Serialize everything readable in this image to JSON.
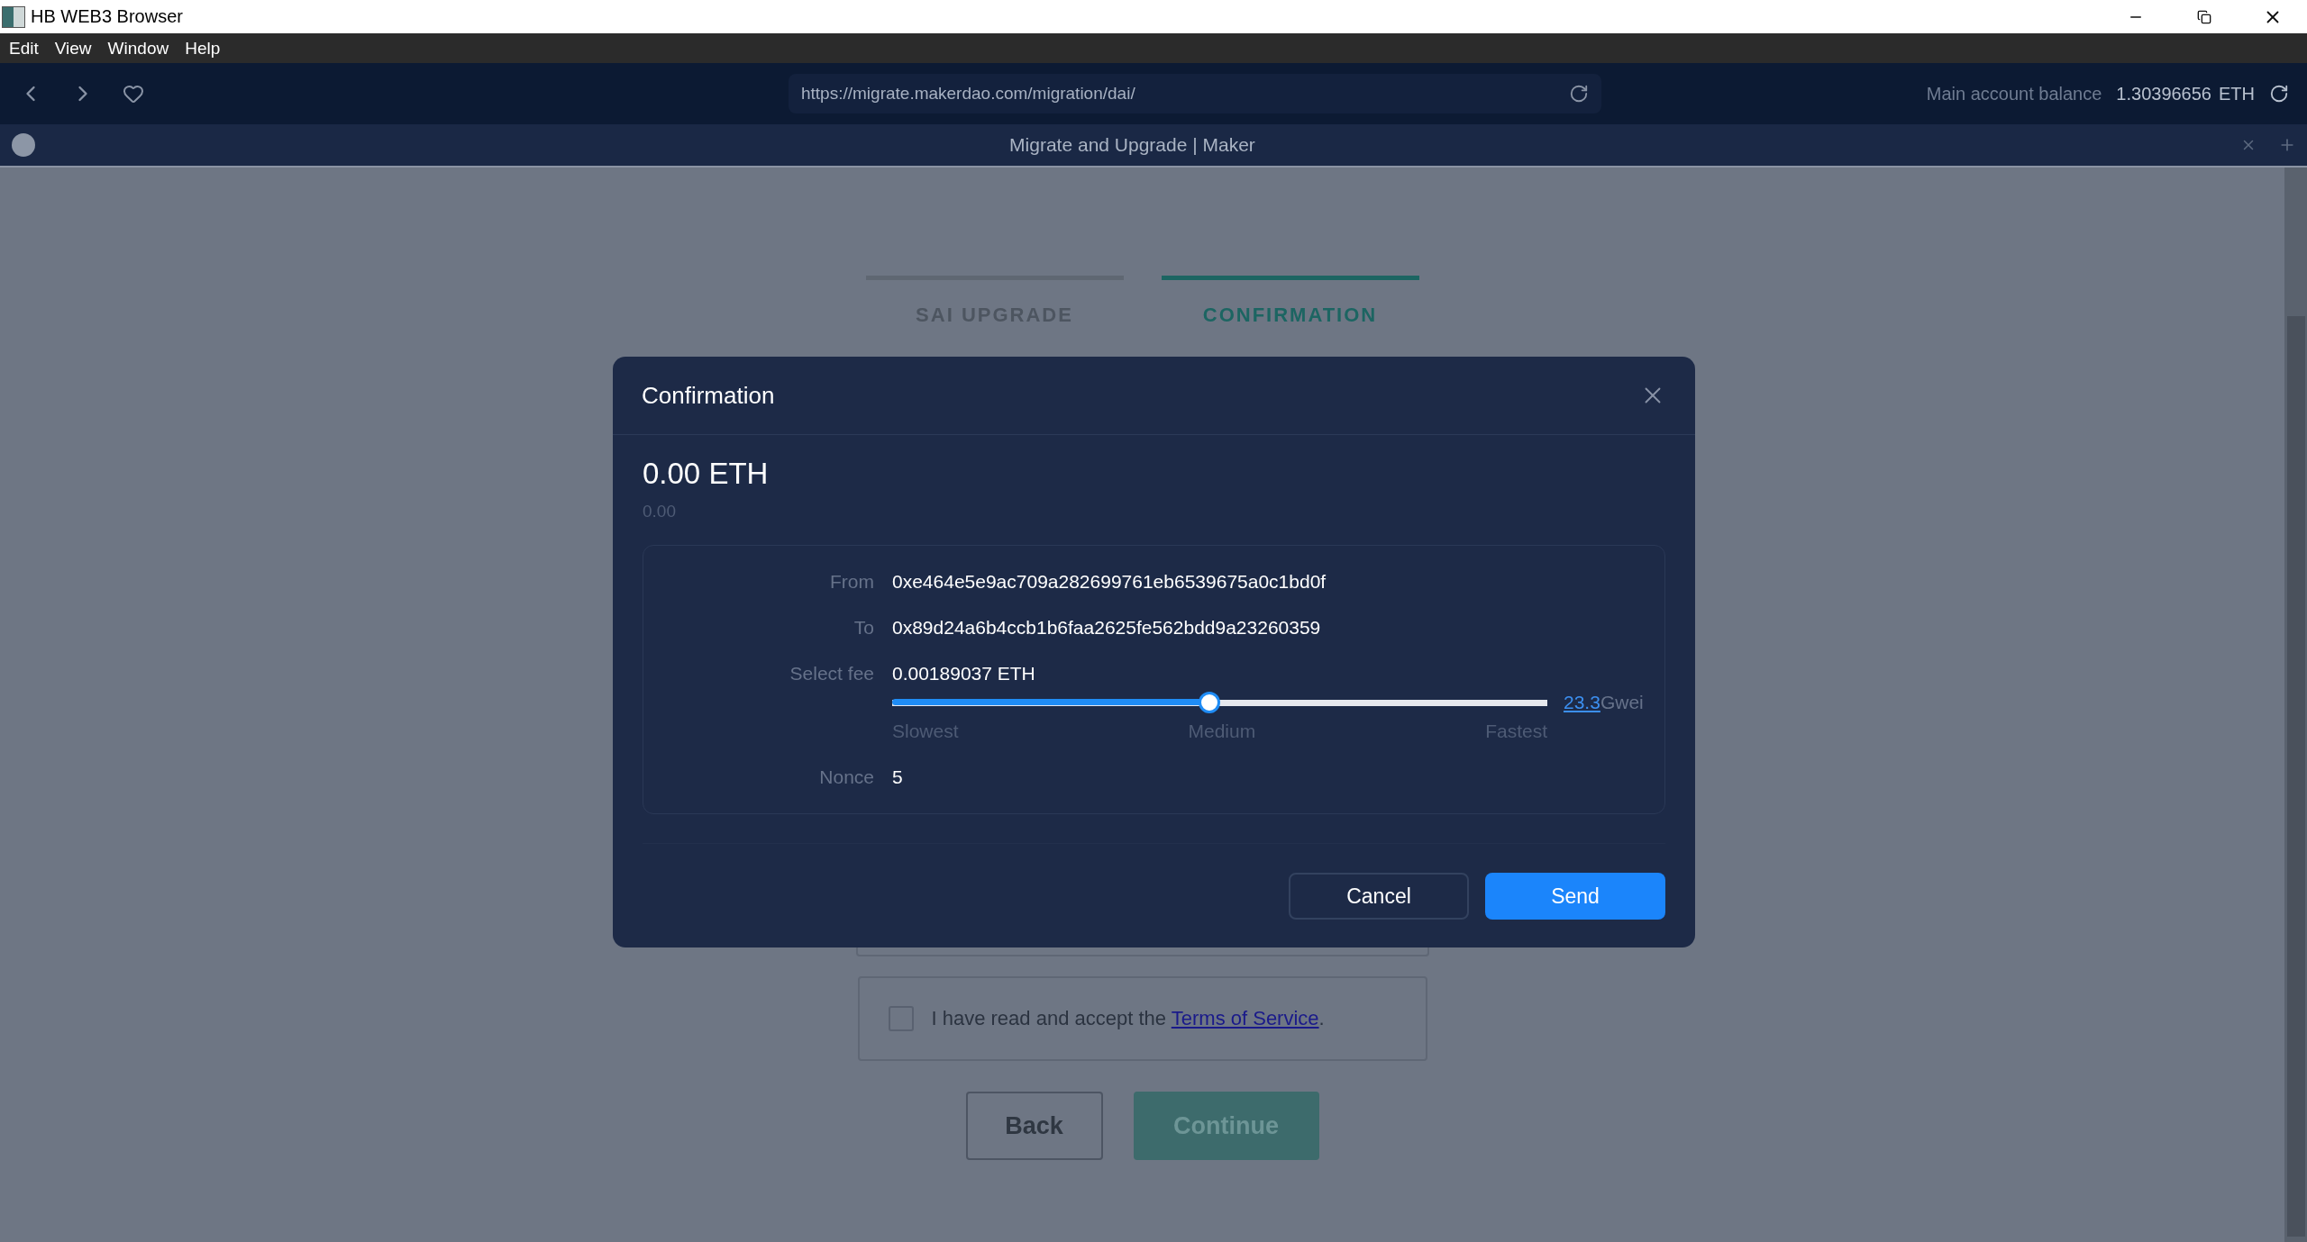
{
  "window": {
    "title": "HB WEB3 Browser"
  },
  "menu": [
    "Edit",
    "View",
    "Window",
    "Help"
  ],
  "nav": {
    "url": "https://migrate.makerdao.com/migration/dai/",
    "balance_label": "Main account balance",
    "balance_value": "1.30396656",
    "balance_unit": "ETH"
  },
  "tab": {
    "title": "Migrate and Upgrade | Maker"
  },
  "steps": [
    {
      "label": "SAI UPGRADE",
      "selected": false
    },
    {
      "label": "CONFIRMATION",
      "selected": true
    }
  ],
  "terms": {
    "checked": false,
    "text": "I have read and accept the",
    "link": "Terms of Service",
    "after": "."
  },
  "buttons": [
    {
      "label": "Back",
      "kind": "secondary"
    },
    {
      "label": "Continue",
      "kind": "primary"
    }
  ],
  "dialog": {
    "title": "Confirmation",
    "amount": "0.00 ETH",
    "amount_sub": "0.00",
    "rows": [
      {
        "label": "From",
        "value": "0xe464e5e9ac709a282699761eb6539675a0c1bd0f"
      },
      {
        "label": "To",
        "value": "0x89d24a6b4ccb1b6faa2625fe562bdd9a23260359"
      }
    ],
    "fee": {
      "label": "Select fee",
      "value": "0.00189037 ETH",
      "level": 0.484,
      "gwei": "23.3",
      "unit": "Gwei",
      "marks": [
        "Slowest",
        "Medium",
        "Fastest"
      ]
    },
    "nonce": {
      "label": "Nonce",
      "value": "5"
    },
    "buttons": [
      {
        "label": "Cancel",
        "kind": "secondary"
      },
      {
        "label": "Send",
        "kind": "primary"
      }
    ]
  }
}
